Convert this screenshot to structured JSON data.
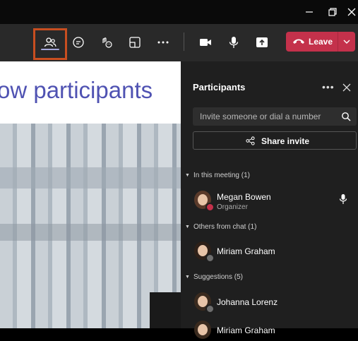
{
  "window": {
    "minimize_icon": "minimize-icon",
    "restore_icon": "restore-icon",
    "close_icon": "close-icon"
  },
  "toolbar": {
    "leave_label": "Leave",
    "leave_color": "#c4314b",
    "highlight_color": "#c84e20"
  },
  "slide": {
    "title_text": "ow participants"
  },
  "participants": {
    "title": "Participants",
    "search_placeholder": "Invite someone or dial a number",
    "share_label": "Share invite",
    "sections": {
      "in_meeting": "In this meeting (1)",
      "others_from_chat": "Others from chat (1)",
      "suggestions": "Suggestions (5)"
    },
    "people": {
      "megan": {
        "name": "Megan Bowen",
        "role": "Organizer"
      },
      "miriam": {
        "name": "Miriam Graham"
      },
      "johanna": {
        "name": "Johanna Lorenz"
      },
      "partial": {
        "name": "Miriam Graham"
      }
    }
  }
}
